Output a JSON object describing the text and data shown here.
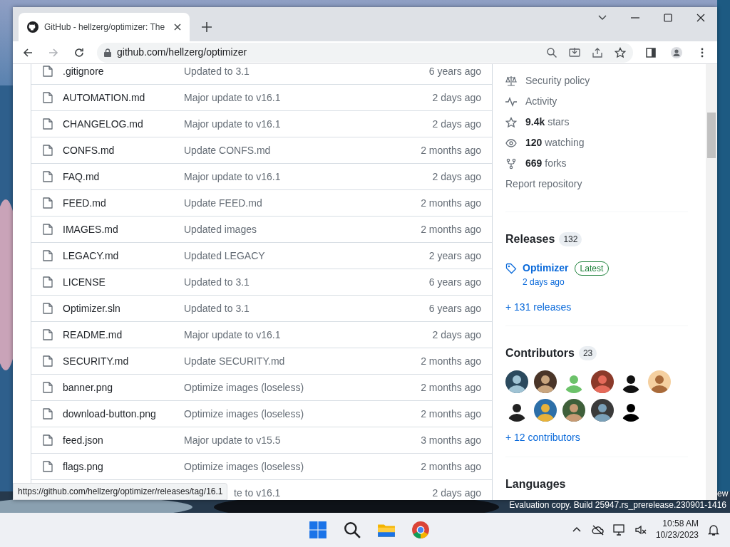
{
  "browser": {
    "tab": {
      "title": "GitHub - hellzerg/optimizer: The",
      "selected": true
    },
    "address": "github.com/hellzerg/optimizer",
    "status_url": "https://github.com/hellzerg/optimizer/releases/tag/16.1"
  },
  "files": [
    {
      "name": ".gitignore",
      "message": "Updated to 3.1",
      "time": "6 years ago"
    },
    {
      "name": "AUTOMATION.md",
      "message": "Major update to v16.1",
      "time": "2 days ago"
    },
    {
      "name": "CHANGELOG.md",
      "message": "Major update to v16.1",
      "time": "2 days ago"
    },
    {
      "name": "CONFS.md",
      "message": "Update CONFS.md",
      "time": "2 months ago"
    },
    {
      "name": "FAQ.md",
      "message": "Major update to v16.1",
      "time": "2 days ago"
    },
    {
      "name": "FEED.md",
      "message": "Update FEED.md",
      "time": "2 months ago"
    },
    {
      "name": "IMAGES.md",
      "message": "Updated images",
      "time": "2 months ago"
    },
    {
      "name": "LEGACY.md",
      "message": "Updated LEGACY",
      "time": "2 years ago"
    },
    {
      "name": "LICENSE",
      "message": "Updated to 3.1",
      "time": "6 years ago"
    },
    {
      "name": "Optimizer.sln",
      "message": "Updated to 3.1",
      "time": "6 years ago"
    },
    {
      "name": "README.md",
      "message": "Major update to v16.1",
      "time": "2 days ago"
    },
    {
      "name": "SECURITY.md",
      "message": "Update SECURITY.md",
      "time": "2 months ago"
    },
    {
      "name": "banner.png",
      "message": "Optimize images (loseless)",
      "time": "2 months ago"
    },
    {
      "name": "download-button.png",
      "message": "Optimize images (loseless)",
      "time": "2 months ago"
    },
    {
      "name": "feed.json",
      "message": "Major update to v15.5",
      "time": "3 months ago"
    },
    {
      "name": "flags.png",
      "message": "Optimize images (loseless)",
      "time": "2 months ago"
    },
    {
      "message": "te to v16.1",
      "time": "2 days ago"
    }
  ],
  "sidebar": {
    "links": [
      {
        "kind": "law",
        "text": "Security policy"
      },
      {
        "kind": "pulse",
        "text": "Activity"
      },
      {
        "kind": "star",
        "text": "**9.4k** stars"
      },
      {
        "kind": "eye",
        "text": "**120** watching"
      },
      {
        "kind": "fork",
        "text": "**669** forks"
      },
      {
        "kind": "plain",
        "text": "Report repository"
      }
    ],
    "releases": {
      "heading": "Releases",
      "count": "132",
      "latest": {
        "name": "Optimizer",
        "badge": "Latest",
        "time": "2 days ago"
      },
      "more": "+ 131 releases"
    },
    "contributors": {
      "heading": "Contributors",
      "count": "23",
      "more": "+ 12 contributors"
    },
    "languages": {
      "heading": "Languages"
    }
  },
  "desktop": {
    "watermark_cut": "ew",
    "watermark": "Evaluation copy. Build 25947.rs_prerelease.230901-1416"
  },
  "taskbar": {
    "time": "10:58 AM",
    "date": "10/23/2023"
  }
}
